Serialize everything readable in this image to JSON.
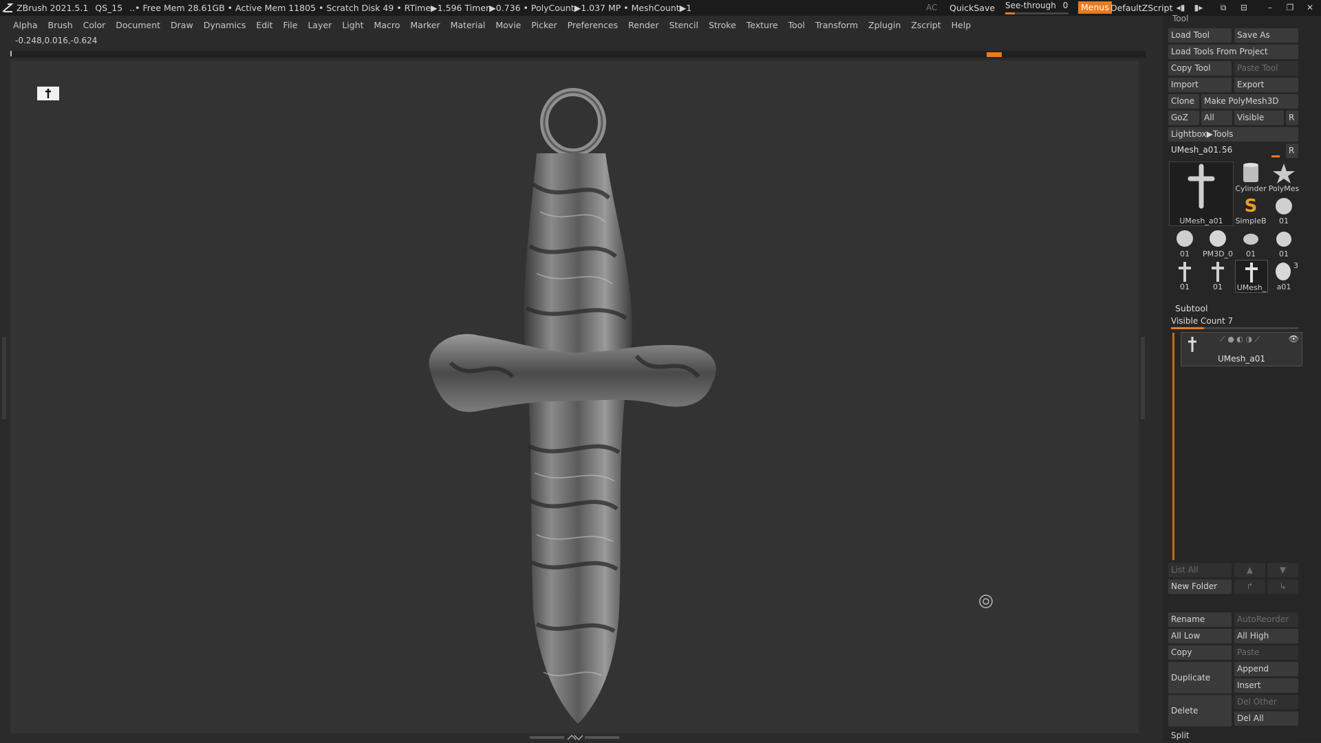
{
  "titlebar": {
    "app": "ZBrush 2021.5.1",
    "project": "QS_15",
    "stats": "..• Free Mem 28.61GB • Active Mem 11805 • Scratch Disk 49 • RTime▶1.596 Timer▶0.736 • PolyCount▶1.037 MP • MeshCount▶1",
    "ac": "AC",
    "quicksave": "QuickSave",
    "see_through": "See-through",
    "see_through_value": "0",
    "menus": "Menus",
    "default_zscript": "DefaultZScript"
  },
  "menubar": [
    "Alpha",
    "Brush",
    "Color",
    "Document",
    "Draw",
    "Dynamics",
    "Edit",
    "File",
    "Layer",
    "Light",
    "Macro",
    "Marker",
    "Material",
    "Movie",
    "Picker",
    "Preferences",
    "Render",
    "Stencil",
    "Stroke",
    "Texture",
    "Tool",
    "Transform",
    "Zplugin",
    "Zscript",
    "Help"
  ],
  "coords": "-0.248,0.016,-0.624",
  "tool_panel": {
    "header": "Tool",
    "load_tool": "Load Tool",
    "save_as": "Save As",
    "load_from_project": "Load Tools From Project",
    "copy_tool": "Copy Tool",
    "paste_tool": "Paste Tool",
    "import": "Import",
    "export": "Export",
    "clone": "Clone",
    "make_polymesh": "Make PolyMesh3D",
    "goz": "GoZ",
    "all": "All",
    "visible": "Visible",
    "r": "R",
    "lightbox": "Lightbox▶Tools",
    "current_tool": "UMesh_a01.",
    "current_tool_value": "56",
    "thumbs": {
      "main": "UMesh_a01",
      "cylinder": "Cylinder",
      "polymesh": "PolyMes",
      "simpleb": "SimpleB",
      "t1": "01",
      "t2": "01",
      "t3": "PM3D_0",
      "t4": "01",
      "t5": "01",
      "t6": "01",
      "t7": "01",
      "t8": "UMesh_",
      "t9": "a01",
      "t9_badge": "3"
    }
  },
  "subtool": {
    "title": "Subtool",
    "visible_count": "Visible Count 7",
    "entry": "UMesh_a01",
    "list_all": "List All",
    "new_folder": "New Folder",
    "rename": "Rename",
    "autoreorder": "AutoReorder",
    "all_low": "All Low",
    "all_high": "All High",
    "copy": "Copy",
    "paste": "Paste",
    "duplicate": "Duplicate",
    "append": "Append",
    "insert": "Insert",
    "delete": "Delete",
    "del_other": "Del Other",
    "del_all": "Del All",
    "split": "Split"
  },
  "colors": {
    "accent": "#e87a20",
    "canvas": "#333333",
    "panel": "#262626",
    "button": "#3a3a3a"
  }
}
